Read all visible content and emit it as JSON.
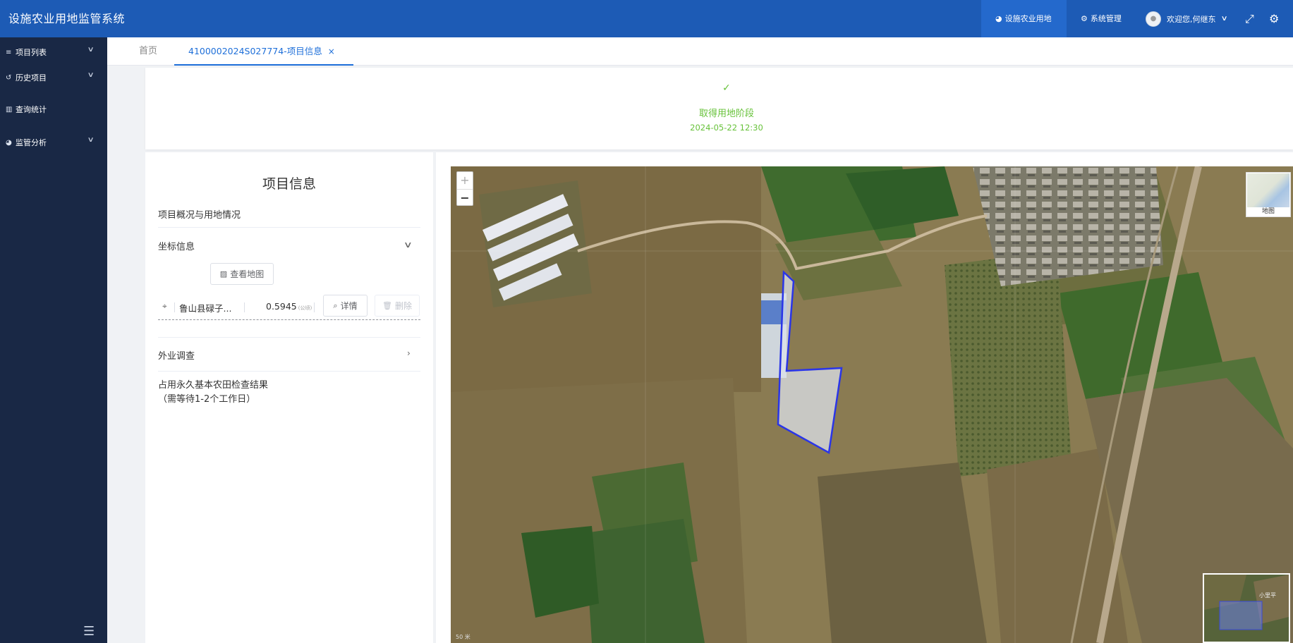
{
  "app": {
    "title": "设施农业用地监管系统"
  },
  "header": {
    "nav": [
      {
        "label": "设施农业用地",
        "icon": "pie-chart-icon",
        "active": true
      },
      {
        "label": "系统管理",
        "icon": "cogs-icon",
        "active": false
      }
    ],
    "user_greeting": "欢迎您,何继东",
    "colors": {
      "header_bg": "#1d5bb5",
      "active_nav": "#2469cc"
    }
  },
  "sidebar": {
    "items": [
      {
        "label": "项目列表",
        "icon": "list-icon",
        "expandable": true
      },
      {
        "label": "历史项目",
        "icon": "history-icon",
        "expandable": true
      },
      {
        "label": "查询统计",
        "icon": "bar-chart-icon",
        "expandable": false
      },
      {
        "label": "监管分析",
        "icon": "pie-chart-icon",
        "expandable": true
      }
    ]
  },
  "tabs": [
    {
      "label": "首页",
      "active": false
    },
    {
      "label": "4100002024S027774-项目信息",
      "active": true,
      "closable": true
    }
  ],
  "status": {
    "stage": "取得用地阶段",
    "time": "2024-05-22 12:30",
    "color": "#67c23a"
  },
  "info": {
    "title": "项目信息",
    "overview": "项目概况与用地情况",
    "coord_section": "坐标信息",
    "view_map_button": "查看地图",
    "coord_row": {
      "name": "鲁山县碌子...",
      "value": "0.5945",
      "unit": "(公顷)",
      "detail_button": "详情",
      "delete_button": "删除"
    },
    "field_survey": "外业调查",
    "farmland_result_line1": "占用永久基本农田检查结果",
    "farmland_result_line2": "（需等待1-2个工作日）"
  },
  "map": {
    "zoom_in": "+",
    "zoom_out": "−",
    "layer_label": "地图",
    "scale_text": "50 米",
    "overview_label": "小里平",
    "parcel_color": "#2a35e8"
  }
}
